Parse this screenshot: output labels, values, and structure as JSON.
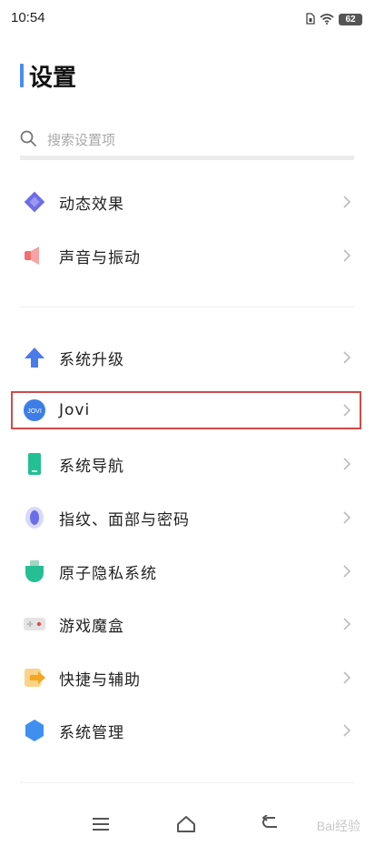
{
  "status_bar": {
    "time": "10:54",
    "battery": "62"
  },
  "page": {
    "title": "设置"
  },
  "search": {
    "placeholder": "搜索设置项"
  },
  "groups": [
    {
      "items": [
        {
          "label": "动态效果",
          "icon": "diamond-icon",
          "color": "#6f6ce6"
        },
        {
          "label": "声音与振动",
          "icon": "speaker-icon",
          "color": "#f07070"
        }
      ]
    },
    {
      "items": [
        {
          "label": "系统升级",
          "icon": "arrow-up-icon",
          "color": "#4b7be8"
        },
        {
          "label": "Jovi",
          "icon": "jovi-icon",
          "color": "#3d7de6"
        },
        {
          "label": "系统导航",
          "icon": "phone-icon",
          "color": "#24bf93"
        },
        {
          "label": "指纹、面部与密码",
          "icon": "fingerprint-icon",
          "color": "#6a6ee8"
        },
        {
          "label": "原子隐私系统",
          "icon": "shield-icon",
          "color": "#26bf94"
        },
        {
          "label": "游戏魔盒",
          "icon": "gamepad-icon",
          "color": "#d9d9d9"
        },
        {
          "label": "快捷与辅助",
          "icon": "shortcut-arrow-icon",
          "color": "#f5a623"
        },
        {
          "label": "系统管理",
          "icon": "hexagon-icon",
          "color": "#3e8ff0"
        }
      ]
    }
  ],
  "jovi_icon_text": "JOVI",
  "watermark": "Bai经验"
}
